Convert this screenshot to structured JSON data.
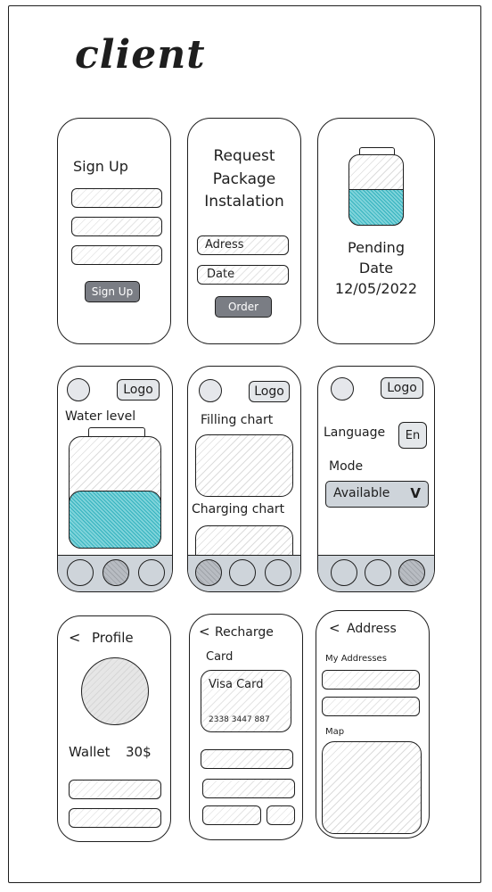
{
  "page": {
    "title": "client"
  },
  "signup": {
    "heading": "Sign Up",
    "button": "Sign Up"
  },
  "request": {
    "heading_l1": "Request",
    "heading_l2": "Package",
    "heading_l3": "Instalation",
    "address_placeholder": "Adress",
    "date_placeholder": "Date",
    "order_button": "Order"
  },
  "pending": {
    "status": "Pending",
    "date_label": "Date",
    "date_value": "12/05/2022",
    "water_fill_fraction": 0.45
  },
  "water": {
    "logo": "Logo",
    "label": "Water level",
    "water_fill_fraction": 0.47
  },
  "charts": {
    "logo": "Logo",
    "filling_label": "Filling chart",
    "charging_label": "Charging chart"
  },
  "settings": {
    "logo": "Logo",
    "language_label": "Language",
    "language_value": "En",
    "mode_label": "Mode",
    "mode_value": "Available",
    "mode_chevron": "V"
  },
  "profile": {
    "back": "<",
    "heading": "Profile",
    "wallet_label": "Wallet",
    "wallet_value": "30$"
  },
  "recharge": {
    "back": "<",
    "heading": "Recharge",
    "card_label": "Card",
    "card_name": "Visa Card",
    "card_number": "2338 3447 887"
  },
  "address": {
    "back": "<",
    "heading": "Address",
    "my_addresses": "My Addresses",
    "map_label": "Map"
  },
  "icons": {
    "back": "chevron-left-icon",
    "nav_home": "circle-icon",
    "avatar": "avatar-circle",
    "jar": "water-tank-icon"
  }
}
